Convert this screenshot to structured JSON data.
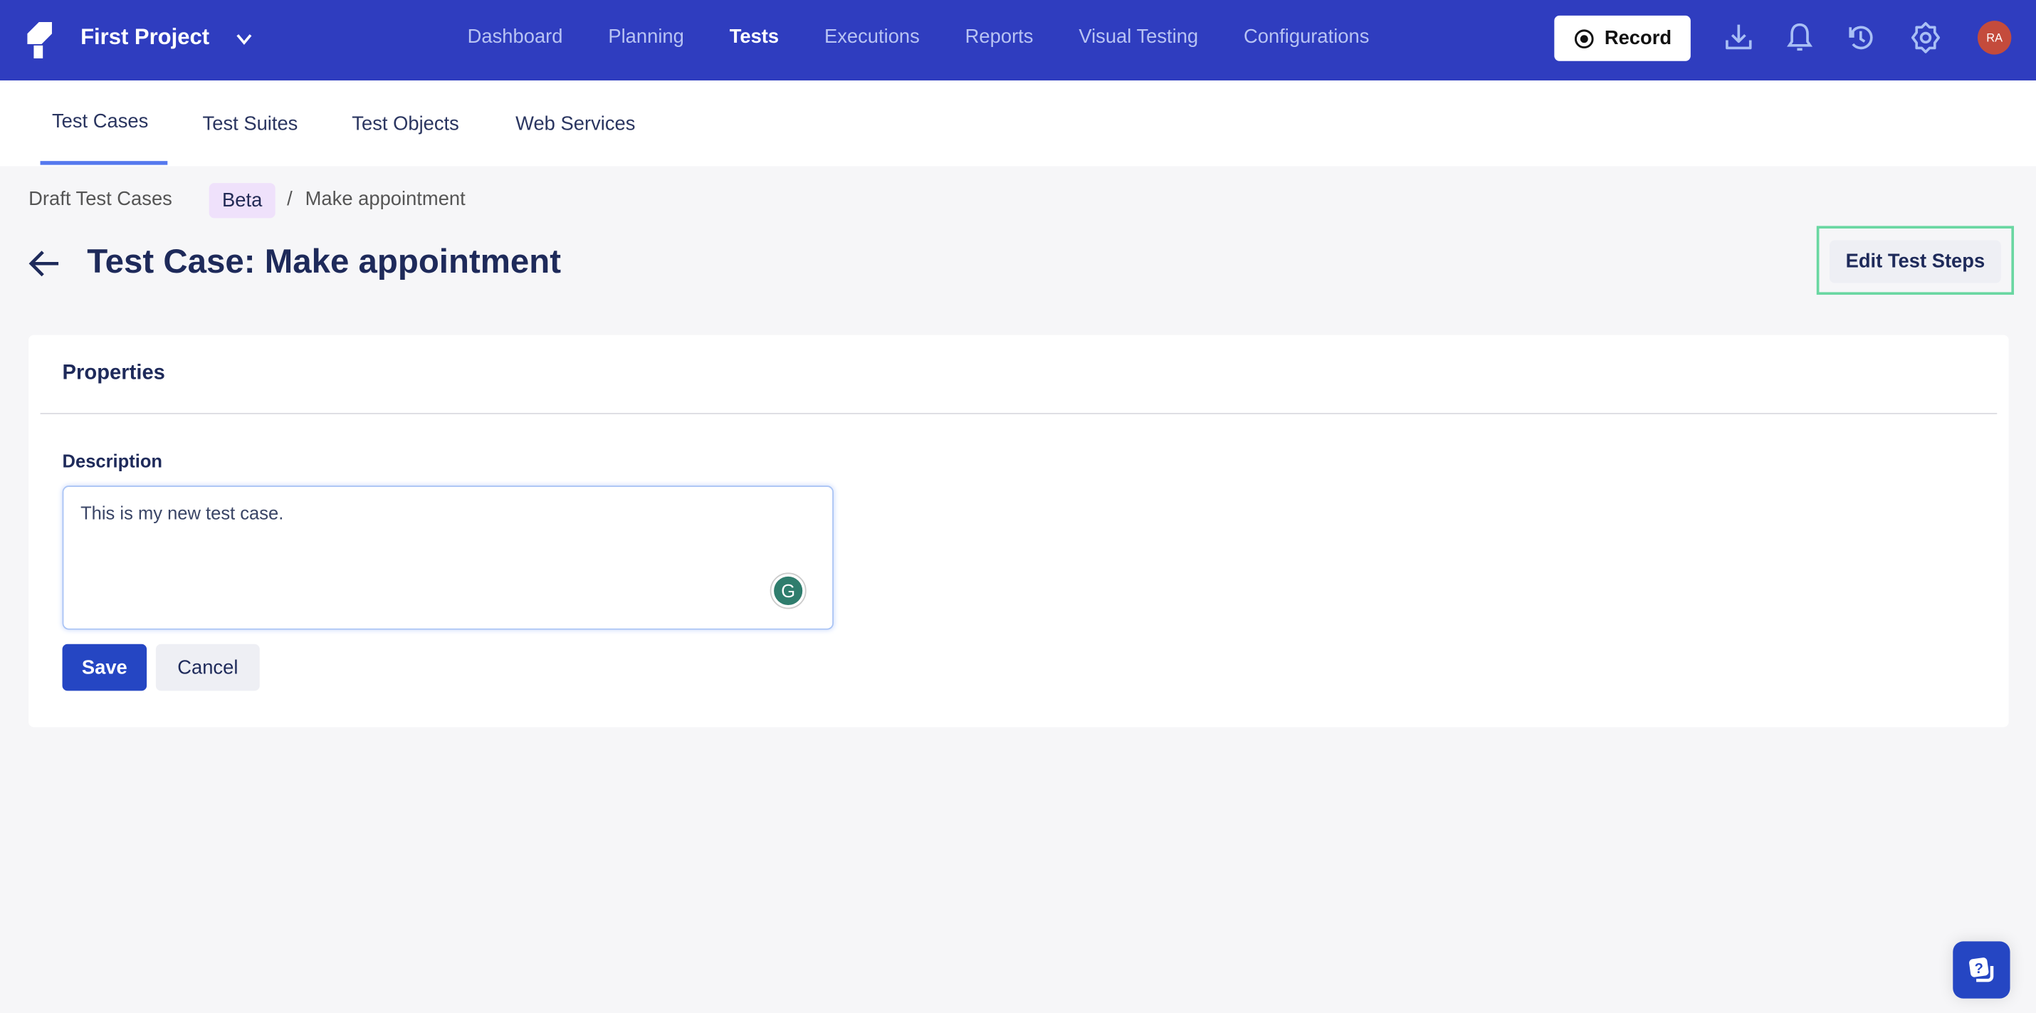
{
  "header": {
    "project": "First Project",
    "nav": [
      "Dashboard",
      "Planning",
      "Tests",
      "Executions",
      "Reports",
      "Visual Testing",
      "Configurations"
    ],
    "active_nav": "Tests",
    "record_label": "Record",
    "avatar_initials": "RA",
    "icons": [
      "download-icon",
      "bell-icon",
      "history-icon",
      "gear-icon"
    ]
  },
  "subnav": {
    "tabs": [
      "Test Cases",
      "Test Suites",
      "Test Objects",
      "Web Services"
    ],
    "active": "Test Cases"
  },
  "breadcrumb": {
    "root": "Draft Test Cases",
    "badge": "Beta",
    "separator": "/",
    "current": "Make appointment"
  },
  "page": {
    "title": "Test Case: Make appointment",
    "edit_steps_label": "Edit Test Steps"
  },
  "properties": {
    "heading": "Properties",
    "description_label": "Description",
    "description_value": "This is my new test case.",
    "save_label": "Save",
    "cancel_label": "Cancel"
  },
  "colors": {
    "brand": "#2f3dbf",
    "primary_button": "#2546c3",
    "highlight": "#6ad7a2",
    "avatar": "#c44b3c"
  }
}
